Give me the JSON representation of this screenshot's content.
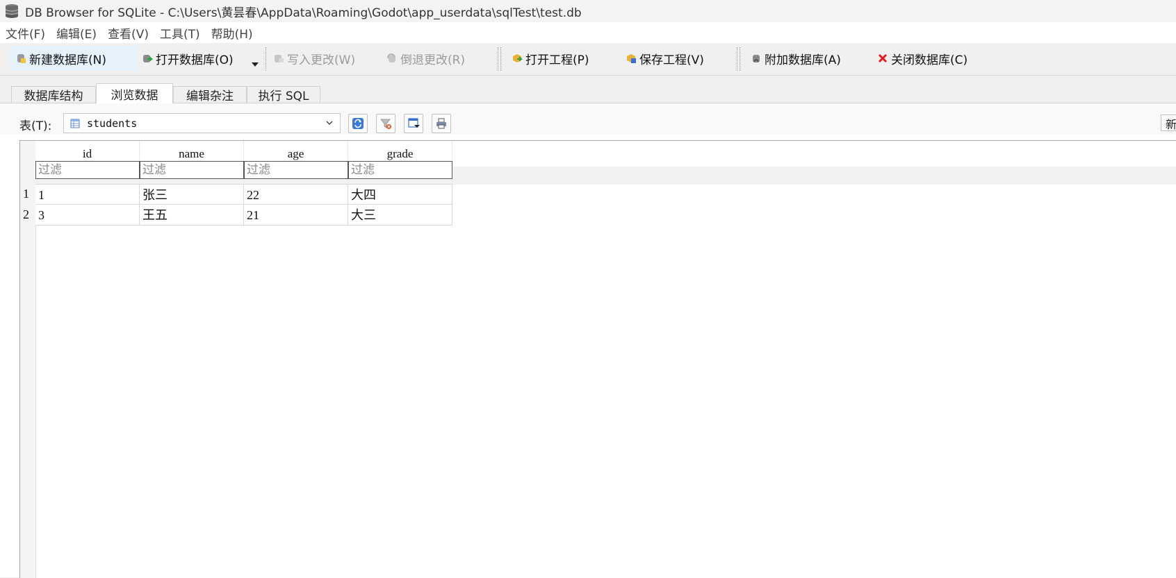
{
  "window": {
    "title": "DB Browser for SQLite - C:\\Users\\黄昙春\\AppData\\Roaming\\Godot\\app_userdata\\sqlTest\\test.db",
    "icon": "database-icon"
  },
  "menu": [
    "文件(F)",
    "编辑(E)",
    "查看(V)",
    "工具(T)",
    "帮助(H)"
  ],
  "toolbar": {
    "new_db": "新建数据库(N)",
    "open_db": "打开数据库(O)",
    "write_changes": "写入更改(W)",
    "revert_changes": "倒退更改(R)",
    "open_project": "打开工程(P)",
    "save_project": "保存工程(V)",
    "attach_db": "附加数据库(A)",
    "close_db": "关闭数据库(C)"
  },
  "tabs": [
    "数据库结构",
    "浏览数据",
    "编辑杂注",
    "执行 SQL"
  ],
  "selected_tab": "浏览数据",
  "browse": {
    "table_label": "表(T):",
    "table_selected": "students",
    "right_button_label": "新"
  },
  "grid": {
    "columns": [
      "id",
      "name",
      "age",
      "grade"
    ],
    "filter_placeholder": "过滤",
    "row_numbers": [
      "1",
      "2"
    ],
    "rows": [
      [
        "1",
        "张三",
        "22",
        "大四"
      ],
      [
        "3",
        "王五",
        "21",
        "大三"
      ]
    ]
  },
  "colors": {
    "active_button_bg": "#e5f1fb",
    "close_icon": "#e02020",
    "disabled_text": "#9a9a9a"
  }
}
